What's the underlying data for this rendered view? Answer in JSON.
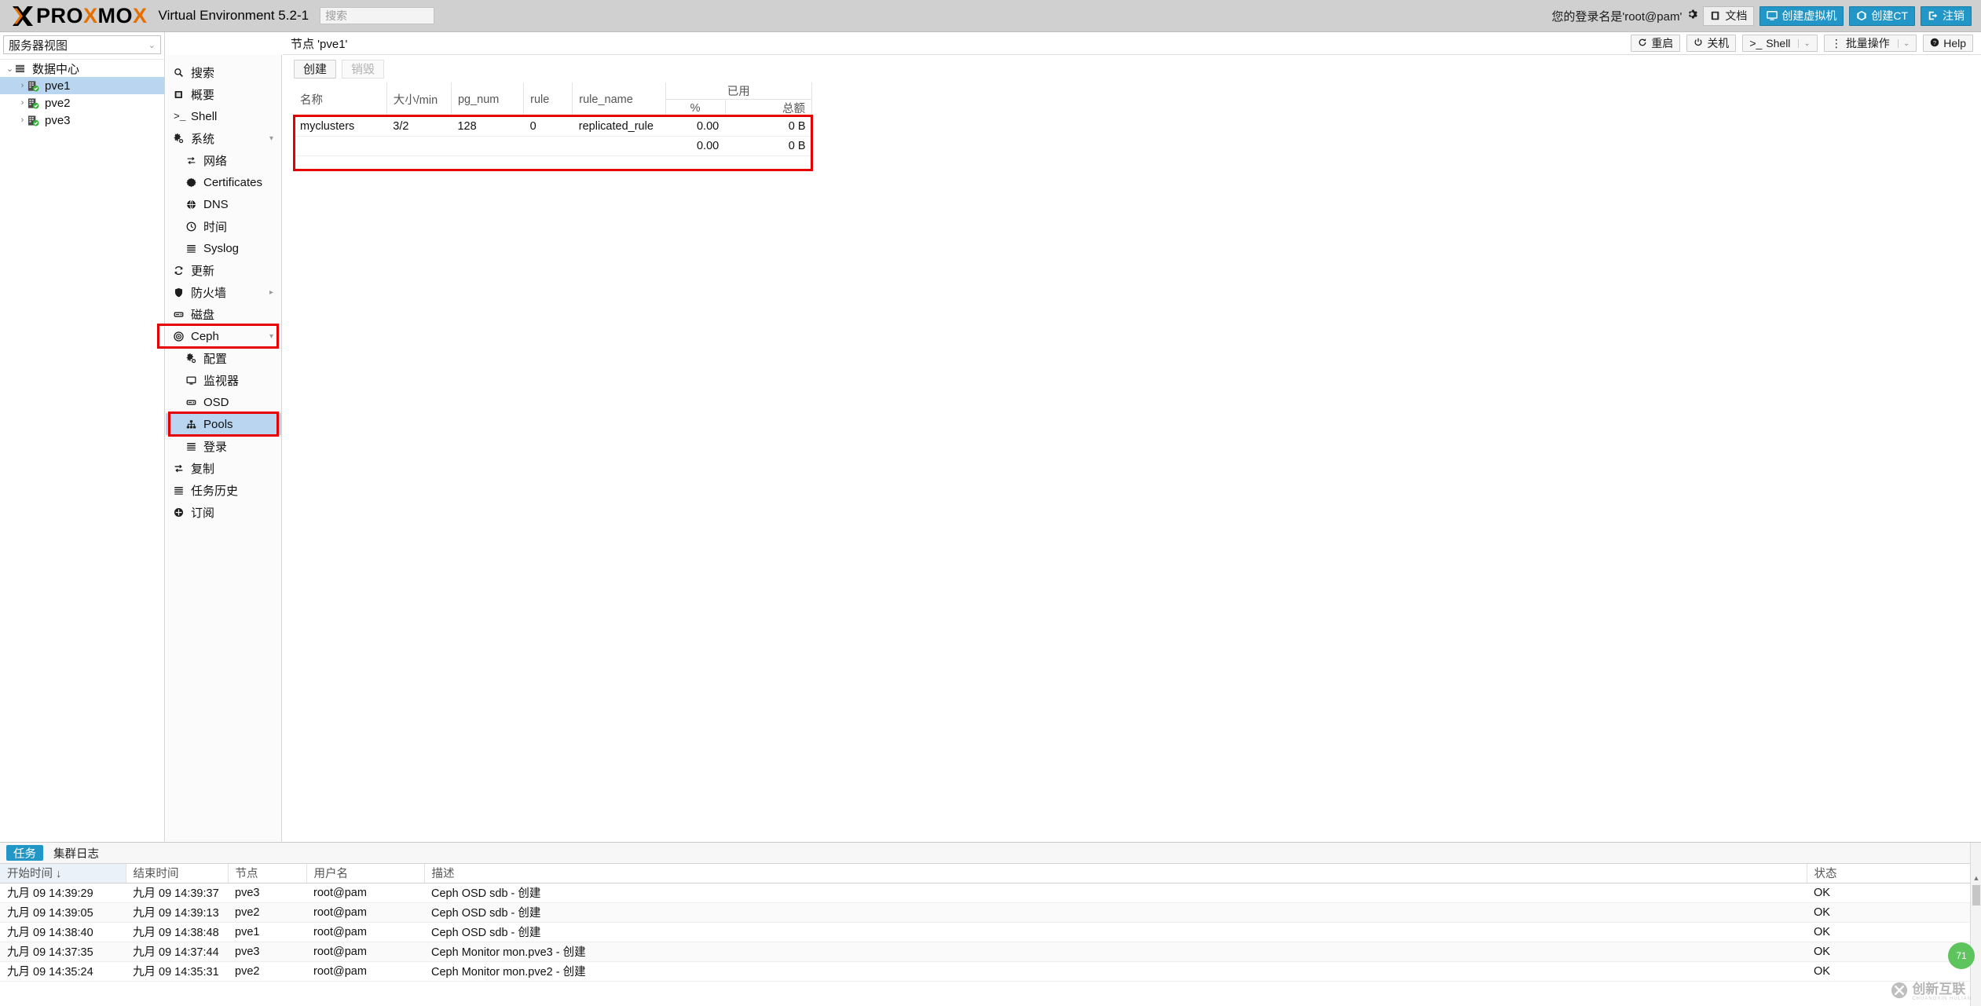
{
  "header": {
    "brand_pro": "PRO",
    "brand_x": "X",
    "brand_mo": "MO",
    "brand_x2": "X",
    "product": "Virtual Environment 5.2-1",
    "search_placeholder": "搜索",
    "user_label": "您的登录名是'root@pam'",
    "buttons": [
      {
        "label": "文档",
        "icon": "book-icon",
        "style": "default"
      },
      {
        "label": "创建虚拟机",
        "icon": "monitor-icon",
        "style": "primary"
      },
      {
        "label": "创建CT",
        "icon": "container-icon",
        "style": "primary"
      },
      {
        "label": "注销",
        "icon": "logout-icon",
        "style": "primary"
      }
    ]
  },
  "sidebar": {
    "view_selector": "服务器视图",
    "tree": [
      {
        "label": "数据中心",
        "level": 0,
        "icon": "datacenter-icon",
        "selected": false,
        "expanded": true
      },
      {
        "label": "pve1",
        "level": 1,
        "icon": "node-icon",
        "selected": true,
        "expanded": false
      },
      {
        "label": "pve2",
        "level": 1,
        "icon": "node-icon",
        "selected": false,
        "expanded": false
      },
      {
        "label": "pve3",
        "level": 1,
        "icon": "node-icon",
        "selected": false,
        "expanded": false
      }
    ]
  },
  "nav": {
    "items": [
      {
        "label": "搜索",
        "icon": "search-icon",
        "sub": false,
        "selected": false,
        "caret": ""
      },
      {
        "label": "概要",
        "icon": "summary-icon",
        "sub": false,
        "selected": false,
        "caret": ""
      },
      {
        "label": "Shell",
        "icon": "shell-icon",
        "sub": false,
        "selected": false,
        "caret": ""
      },
      {
        "label": "系统",
        "icon": "gear-icon",
        "sub": false,
        "selected": false,
        "caret": "down"
      },
      {
        "label": "网络",
        "icon": "network-icon",
        "sub": true,
        "selected": false,
        "caret": ""
      },
      {
        "label": "Certificates",
        "icon": "certificate-icon",
        "sub": true,
        "selected": false,
        "caret": ""
      },
      {
        "label": "DNS",
        "icon": "globe-icon",
        "sub": true,
        "selected": false,
        "caret": ""
      },
      {
        "label": "时间",
        "icon": "clock-icon",
        "sub": true,
        "selected": false,
        "caret": ""
      },
      {
        "label": "Syslog",
        "icon": "list-icon",
        "sub": true,
        "selected": false,
        "caret": ""
      },
      {
        "label": "更新",
        "icon": "refresh-icon",
        "sub": false,
        "selected": false,
        "caret": ""
      },
      {
        "label": "防火墙",
        "icon": "shield-icon",
        "sub": false,
        "selected": false,
        "caret": "right"
      },
      {
        "label": "磁盘",
        "icon": "disk-icon",
        "sub": false,
        "selected": false,
        "caret": ""
      },
      {
        "label": "Ceph",
        "icon": "ceph-icon",
        "sub": false,
        "selected": false,
        "caret": "down"
      },
      {
        "label": "配置",
        "icon": "gear-icon",
        "sub": true,
        "selected": false,
        "caret": ""
      },
      {
        "label": "监视器",
        "icon": "monitor-icon",
        "sub": true,
        "selected": false,
        "caret": ""
      },
      {
        "label": "OSD",
        "icon": "disk-icon",
        "sub": true,
        "selected": false,
        "caret": ""
      },
      {
        "label": "Pools",
        "icon": "pools-icon",
        "sub": true,
        "selected": true,
        "caret": ""
      },
      {
        "label": "登录",
        "icon": "list-icon",
        "sub": true,
        "selected": false,
        "caret": ""
      },
      {
        "label": "复制",
        "icon": "replication-icon",
        "sub": false,
        "selected": false,
        "caret": ""
      },
      {
        "label": "任务历史",
        "icon": "history-icon",
        "sub": false,
        "selected": false,
        "caret": ""
      },
      {
        "label": "订阅",
        "icon": "subscription-icon",
        "sub": false,
        "selected": false,
        "caret": ""
      }
    ]
  },
  "node_bar": {
    "title": "节点 'pve1'",
    "tools": [
      {
        "label": "重启",
        "icon": "restart-icon",
        "split": false
      },
      {
        "label": "关机",
        "icon": "power-icon",
        "split": false
      },
      {
        "label": "Shell",
        "icon": "shell-icon",
        "split": true
      },
      {
        "label": "批量操作",
        "icon": "kebab-icon",
        "split": true
      },
      {
        "label": "Help",
        "icon": "help-icon",
        "split": false
      }
    ]
  },
  "pools": {
    "toolbar": {
      "create_label": "创建",
      "destroy_label": "销毁"
    },
    "columns": {
      "name": "名称",
      "size_min": "大小/min",
      "pg_num": "pg_num",
      "rule": "rule",
      "rule_name": "rule_name",
      "used_group": "已用",
      "used_pct": "%",
      "used_total": "总额"
    },
    "rows": [
      {
        "name": "myclusters",
        "size_min": "3/2",
        "pg_num": "128",
        "rule": "0",
        "rule_name": "replicated_rule",
        "used_pct": "0.00",
        "used_total": "0 B"
      },
      {
        "name": "",
        "size_min": "",
        "pg_num": "",
        "rule": "",
        "rule_name": "",
        "used_pct": "0.00",
        "used_total": "0 B"
      }
    ]
  },
  "tasks": {
    "tabs": [
      {
        "label": "任务",
        "active": true
      },
      {
        "label": "集群日志",
        "active": false
      }
    ],
    "columns": {
      "start": "开始时间",
      "sort_arrow": "↓",
      "end": "结束时间",
      "node": "节点",
      "user": "用户名",
      "description": "描述",
      "status": "状态"
    },
    "rows": [
      {
        "start": "九月 09 14:39:29",
        "end": "九月 09 14:39:37",
        "node": "pve3",
        "user": "root@pam",
        "description": "Ceph OSD sdb - 创建",
        "status": "OK"
      },
      {
        "start": "九月 09 14:39:05",
        "end": "九月 09 14:39:13",
        "node": "pve2",
        "user": "root@pam",
        "description": "Ceph OSD sdb - 创建",
        "status": "OK"
      },
      {
        "start": "九月 09 14:38:40",
        "end": "九月 09 14:38:48",
        "node": "pve1",
        "user": "root@pam",
        "description": "Ceph OSD sdb - 创建",
        "status": "OK"
      },
      {
        "start": "九月 09 14:37:35",
        "end": "九月 09 14:37:44",
        "node": "pve3",
        "user": "root@pam",
        "description": "Ceph Monitor mon.pve3 - 创建",
        "status": "OK"
      },
      {
        "start": "九月 09 14:35:24",
        "end": "九月 09 14:35:31",
        "node": "pve2",
        "user": "root@pam",
        "description": "Ceph Monitor mon.pve2 - 创建",
        "status": "OK"
      }
    ]
  },
  "watermark": {
    "text": "创新互联",
    "sub": "CHUANGXIN HULIAN",
    "badge": "71"
  },
  "colors": {
    "accent": "#2196c7",
    "header_bg": "#d0d0d0",
    "selection": "#b9d5ef",
    "highlight_box": "#e60000",
    "brand_orange": "#e57000"
  }
}
